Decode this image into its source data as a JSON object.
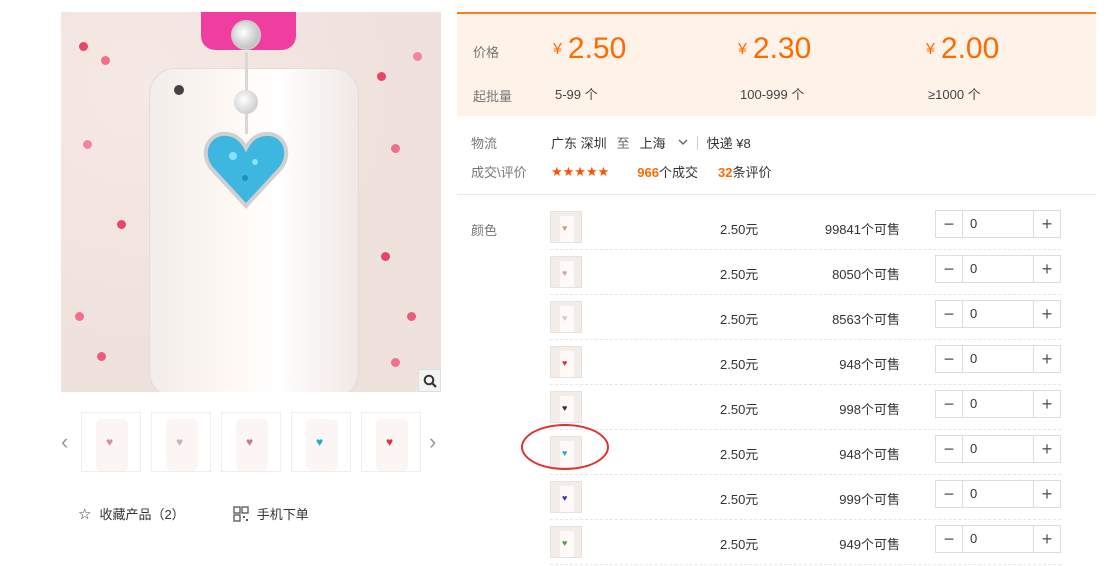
{
  "price_tiers": {
    "price_label": "价格",
    "moq_label": "起批量",
    "currency": "¥",
    "tiers": [
      {
        "price": "2.50",
        "moq": "5-99 个"
      },
      {
        "price": "2.30",
        "moq": "100-999 个"
      },
      {
        "price": "2.00",
        "moq": "≥1000 个"
      }
    ]
  },
  "logistics": {
    "label": "物流",
    "from": "广东 深圳",
    "to_word": "至",
    "to": "上海",
    "shipping": "快递 ¥8"
  },
  "deals": {
    "label": "成交\\评价",
    "stars": "★★★★★",
    "deal_count": "966",
    "deal_suffix": "个成交",
    "review_count": "32",
    "review_suffix": "条评价"
  },
  "sku": {
    "label": "颜色",
    "rows": [
      {
        "price": "2.50元",
        "stock": "99841个可售",
        "qty": "0",
        "heart": "♥",
        "heart_color": "#c8a27a"
      },
      {
        "price": "2.50元",
        "stock": "8050个可售",
        "qty": "0",
        "heart": "♥",
        "heart_color": "#d9a0b0"
      },
      {
        "price": "2.50元",
        "stock": "8563个可售",
        "qty": "0",
        "heart": "♥",
        "heart_color": "#cccccc"
      },
      {
        "price": "2.50元",
        "stock": "948个可售",
        "qty": "0",
        "heart": "♥",
        "heart_color": "#e0303a"
      },
      {
        "price": "2.50元",
        "stock": "998个可售",
        "qty": "0",
        "heart": "♥",
        "heart_color": "#333333"
      },
      {
        "price": "2.50元",
        "stock": "948个可售",
        "qty": "0",
        "heart": "♥",
        "heart_color": "#29a8d8"
      },
      {
        "price": "2.50元",
        "stock": "999个可售",
        "qty": "0",
        "heart": "♥",
        "heart_color": "#3a3aa8"
      },
      {
        "price": "2.50元",
        "stock": "949个可售",
        "qty": "0",
        "heart": "♥",
        "heart_color": "#3aa84a"
      }
    ],
    "minus": "−",
    "plus": "+"
  },
  "gallery": {
    "prev": "‹",
    "next": "›",
    "thumb_hearts": [
      "#d88ea0",
      "#bbbbbb",
      "#c77aa0",
      "#29a8d8",
      "#e0303a"
    ]
  },
  "actions": {
    "favorite": "收藏产品（2）",
    "mobile_order": "手机下单"
  },
  "colors": {
    "accent": "#ff6a00",
    "price_bg": "#fff3e9",
    "highlight": "#e0312b"
  }
}
